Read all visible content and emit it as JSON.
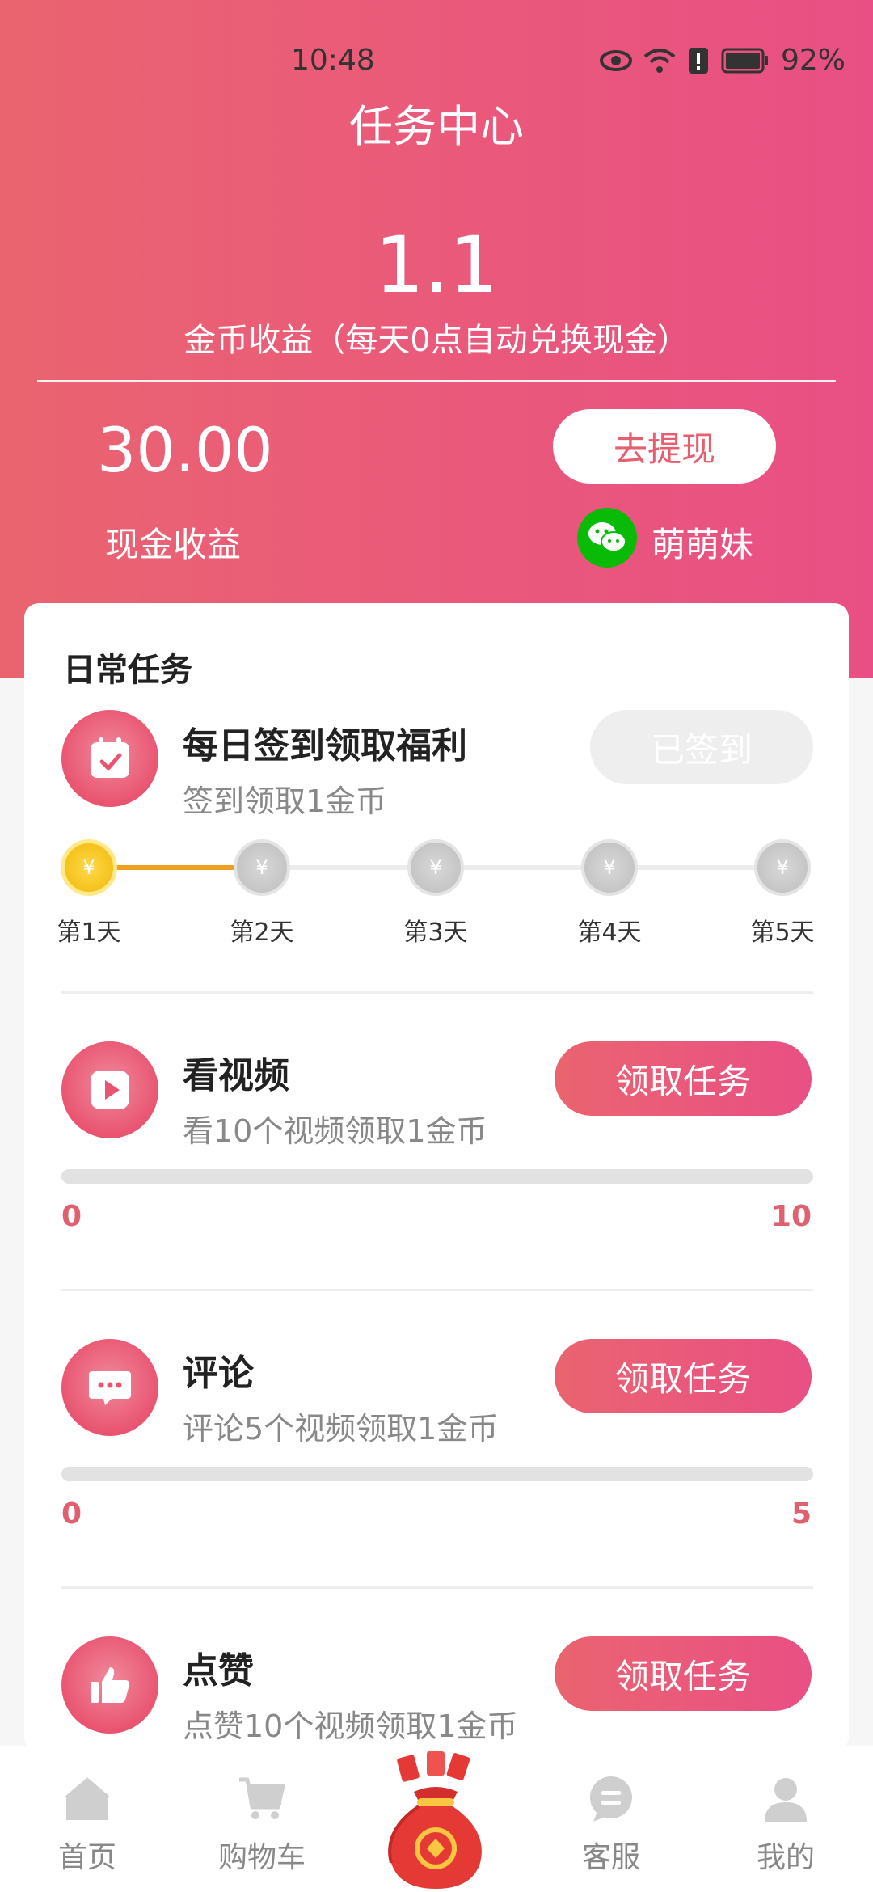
{
  "status": {
    "time": "10:48",
    "battery": "92%"
  },
  "header": {
    "title": "任务中心",
    "coin_value": "1.1",
    "coin_label": "金币收益（每天0点自动兑换现金）",
    "cash_value": "30.00",
    "cash_label": "现金收益",
    "withdraw_label": "去提现",
    "wechat_name": "萌萌妹"
  },
  "daily": {
    "section_title": "日常任务",
    "signin": {
      "title": "每日签到领取福利",
      "subtitle": "签到领取1金币",
      "button": "已签到",
      "days": [
        "第1天",
        "第2天",
        "第3天",
        "第4天",
        "第5天"
      ],
      "completed_days": 1
    },
    "tasks": [
      {
        "title": "看视频",
        "subtitle": "看10个视频领取1金币",
        "button": "领取任务",
        "progress_min": "0",
        "progress_max": "10",
        "progress": 0
      },
      {
        "title": "评论",
        "subtitle": "评论5个视频领取1金币",
        "button": "领取任务",
        "progress_min": "0",
        "progress_max": "5",
        "progress": 0
      },
      {
        "title": "点赞",
        "subtitle": "点赞10个视频领取1金币",
        "button": "领取任务"
      }
    ]
  },
  "nav": {
    "items": [
      "首页",
      "购物车",
      "客服",
      "我的"
    ]
  },
  "colors": {
    "accent": "#e94f84",
    "accent_start": "#ea6470",
    "gold": "#f5c21b"
  }
}
